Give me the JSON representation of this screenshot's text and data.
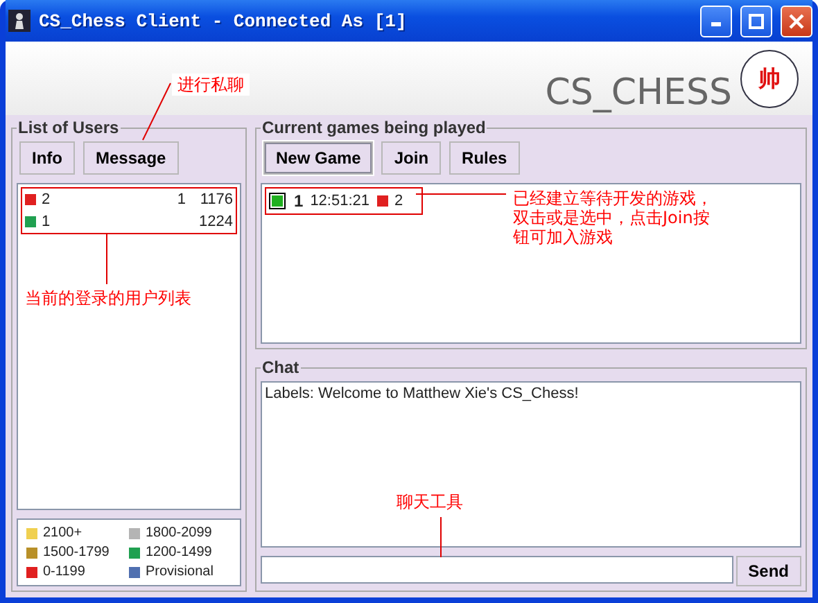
{
  "window": {
    "title": "CS_Chess Client - Connected As [1]"
  },
  "header": {
    "brand": "CS_CHESS",
    "logo_glyph": "帅"
  },
  "users_panel": {
    "title": "List of Users",
    "buttons": [
      {
        "label": "Info",
        "focused": false
      },
      {
        "label": "Message",
        "focused": false
      }
    ],
    "users": [
      {
        "name": "2",
        "column_2": "1",
        "rating": "1176",
        "color": "#e02020"
      },
      {
        "name": "1",
        "rating": "1224",
        "color": "#20a050"
      }
    ],
    "legend": [
      {
        "label": "2100+",
        "color": "#f0d050"
      },
      {
        "label": "1800-2099",
        "color": "#b4b4b4"
      },
      {
        "label": "1500-1799",
        "color": "#b89028"
      },
      {
        "label": "1200-1499",
        "color": "#20a050"
      },
      {
        "label": "0-1199",
        "color": "#e02020"
      },
      {
        "label": "Provisional",
        "color": "#5070b0"
      }
    ]
  },
  "games_panel": {
    "title": "Current games being played",
    "buttons": [
      {
        "label": "New Game",
        "focused": true
      },
      {
        "label": "Join",
        "focused": false
      },
      {
        "label": "Rules",
        "focused": false
      }
    ],
    "games": [
      {
        "player": {
          "name": "1",
          "color": "#20b020"
        },
        "time": "12:51:21",
        "opponent": {
          "name": "2",
          "color": "#e02020"
        }
      }
    ]
  },
  "chat": {
    "title": "Chat",
    "messages": [
      "Labels: Welcome to Matthew Xie's CS_Chess!"
    ],
    "send": "Send"
  },
  "annotations": [
    {
      "lines": [
        "进行私聊"
      ]
    },
    {
      "lines": [
        "当前的登录的用户列表"
      ]
    },
    {
      "lines": [
        "已经建立等待开发的游戏，",
        "双击或是选中，点击Join按",
        "钮可加入游戏"
      ]
    },
    {
      "lines": [
        "聊天工具"
      ]
    }
  ]
}
